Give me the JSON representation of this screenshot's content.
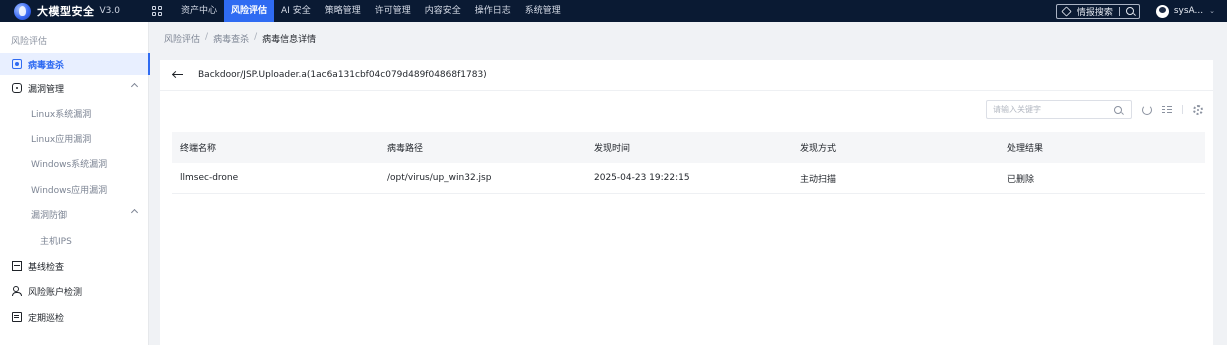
{
  "app": {
    "title": "大模型安全",
    "version": "V3.0"
  },
  "nav": [
    {
      "label": "资产中心",
      "active": false
    },
    {
      "label": "风险评估",
      "active": true
    },
    {
      "label": "AI 安全",
      "active": false
    },
    {
      "label": "策略管理",
      "active": false
    },
    {
      "label": "许可管理",
      "active": false
    },
    {
      "label": "内容安全",
      "active": false
    },
    {
      "label": "操作日志",
      "active": false
    },
    {
      "label": "系统管理",
      "active": false
    }
  ],
  "top_right": {
    "intel_search_label": "情报搜索",
    "user_name": "sysA..."
  },
  "sidebar": {
    "title": "风险评估",
    "items": {
      "virus": "病毒查杀",
      "vuln": "漏洞管理",
      "linux_sys_vuln": "Linux系统漏洞",
      "linux_app_vuln": "Linux应用漏洞",
      "windows_sys_vuln": "Windows系统漏洞",
      "windows_app_vuln": "Windows应用漏洞",
      "vuln_defense": "漏洞防御",
      "host_ips": "主机IPS",
      "baseline": "基线检查",
      "risk_account": "风险账户检测",
      "patrol": "定期巡检"
    }
  },
  "breadcrumb": [
    "风险评估",
    "病毒查杀",
    "病毒信息详情"
  ],
  "detail": {
    "virus_name": "Backdoor/JSP.Uploader.a(1ac6a131cbf04c079d489f04868f1783)",
    "search_placeholder": "请输入关键字"
  },
  "table": {
    "columns": [
      "终端名称",
      "病毒路径",
      "发现时间",
      "发现方式",
      "处理结果"
    ],
    "rows": [
      [
        "llmsec-drone",
        "/opt/virus/up_win32.jsp",
        "2025-04-23 19:22:15",
        "主动扫描",
        "已删除"
      ]
    ]
  },
  "colors": {
    "topbar": "#0a1a33",
    "accent": "#2f6bf2"
  }
}
